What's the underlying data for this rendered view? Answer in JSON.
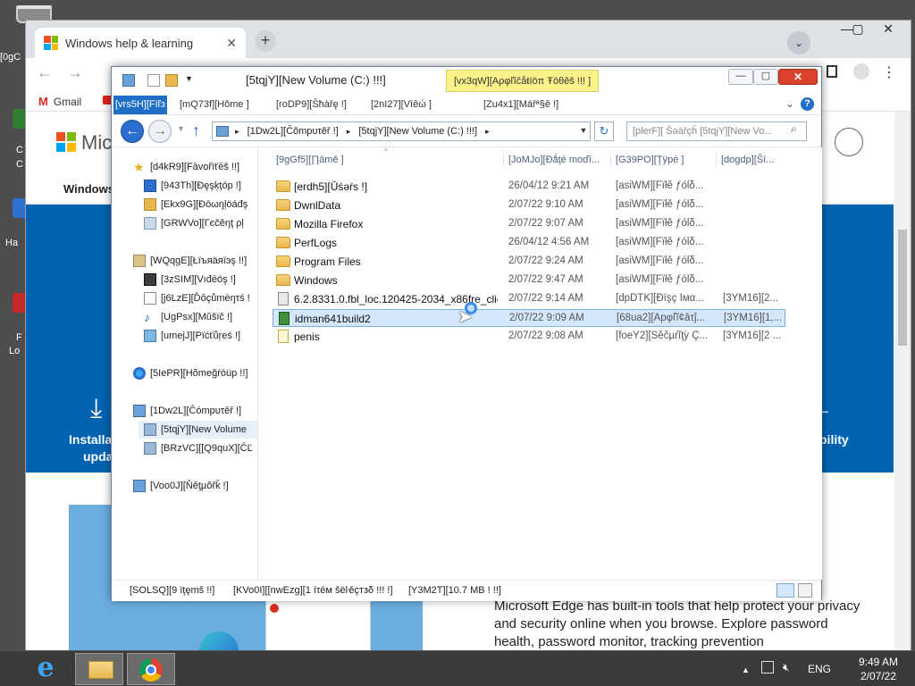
{
  "desktop": {
    "left_labels": [
      "[0gC",
      "C",
      "C",
      "Ha",
      "F",
      "Lo"
    ]
  },
  "browser": {
    "tab_title": "Windows help & learning",
    "tab_close": "✕",
    "new_tab": "+",
    "bookmarks": [
      "Gmail"
    ],
    "ms_logo_text": "Micr",
    "nav_text": "Windows",
    "hero_left": [
      "Installat",
      "upda"
    ],
    "hero_right": "bility",
    "description": "Microsoft Edge has built-in tools that help protect your privacy and security online when you browse. Explore password health, password monitor, tracking prevention"
  },
  "explorer": {
    "title": "[5tqjY][New Volume (C:) !!!]",
    "tooltip": "[vx3qW][Αρφľĭčåŧïöπ Ŧōθěš !!! ]",
    "window_controls": {
      "minimize": "—",
      "maximize": "▢",
      "close": "✕"
    },
    "ribbon_tabs": {
      "file": "[vrs5H][Fïľɜ ]",
      "home": "[mQ73f][Hǒme ]",
      "share": "[roDP9][Ŝħàřę !]",
      "view": "[2nI27][Vïêώ ]",
      "manage": "[Zu4x1][Mářª§ě !]"
    },
    "address": {
      "computer": "[1Dw2L][Ĉǒmpυτěř !]",
      "volume": "[5tqjY][New Volume (C:) !!!]",
      "sep": "▸"
    },
    "search_placeholder": "[plerF][ Šəàřçĥ [5tqjY][New Vo...",
    "nav": {
      "favorites": "[d4kR9][Fāvořïťēš !!]",
      "desktop": "[943Th][Đęşķţóp !]",
      "downloads": "[Ekx9G][Đōωŋļöáđş",
      "recent": "[GRWVo][Гєčěŋţ ρļ",
      "libraries": "[WQqgE][Łïъяäяïэş !!]",
      "videos": "[3zSIM][Vıđēöş !]",
      "documents": "[j6LzE][Ďȏçůmèŋτś !",
      "music": "[UgPsx][Mŭšïč !]",
      "pictures": "[umejJ][Pïćťůŗeś !]",
      "homegroup": "[5IePR][Hõmeğŕōüp !!]",
      "computer": "[1Dw2L][Ĉómpυτěř !]",
      "new_volume": "[5tqjY][New Volume",
      "other_drive": "[BRzVC][[Q9quX][ĈĽ",
      "network": "[Voo0J][Ňěţµŏřǩ !]"
    },
    "columns": {
      "name": "[9gGf5][∏āmě ]",
      "date": "[JoMJo][Ðǻţé moďī...",
      "type": "[G39PO][Ţÿpé ]",
      "size": "[dogdp][Šī..."
    },
    "files": [
      {
        "name": "[erdh5][Ŭśəŕs !]",
        "date": "26/04/12 9:21 AM",
        "type": "[asiWM][Fïłě ƒóĺδ...",
        "size": "",
        "icon": "folder-icon"
      },
      {
        "name": "DwnlData",
        "date": "2/07/22 9:10 AM",
        "type": "[asiWM][Fïłě ƒóĺδ...",
        "size": "",
        "icon": "folder-icon"
      },
      {
        "name": "Mozilla Firefox",
        "date": "2/07/22 9:07 AM",
        "type": "[asiWM][Fïłě ƒóĺδ...",
        "size": "",
        "icon": "folder-icon"
      },
      {
        "name": "PerfLogs",
        "date": "26/04/12 4:56 AM",
        "type": "[asiWM][Fïłě ƒóĺδ...",
        "size": "",
        "icon": "folder-icon"
      },
      {
        "name": "Program Files",
        "date": "2/07/22 9:24 AM",
        "type": "[asiWM][Fïłě ƒóĺδ...",
        "size": "",
        "icon": "folder-icon"
      },
      {
        "name": "Windows",
        "date": "2/07/22 9:47 AM",
        "type": "[asiWM][Fïłě ƒóĺδ...",
        "size": "",
        "icon": "folder-icon"
      },
      {
        "name": "6.2.8331.0.fbl_loc.120425-2034_x86fre_clie...",
        "date": "2/07/22 9:14 AM",
        "type": "[dpDTK][Ðïşç Ιмα...",
        "size": "[3YM16][2...",
        "icon": "disc-image-icon"
      },
      {
        "name": "idman641build2",
        "date": "2/07/22 9:09 AM",
        "type": "[68ua2][Āрφľĭ¢åτĵ...",
        "size": "[3YM16][1,...",
        "icon": "installer-icon"
      },
      {
        "name": "penis",
        "date": "2/07/22 9:08 AM",
        "type": "[foeY2][Ŝěčµŕĭţỳ Ç...",
        "size": "[3YM16][2 ...",
        "icon": "certificate-icon"
      }
    ],
    "status": {
      "items": "[SOLSQ][9 ïţęmš !!]",
      "selected": "[KVo0I][[nwEzg][1 ïτéм šëŀěçтзδ !!! !]",
      "size": "[Y3M2T][10.7 MB ! !!]"
    }
  },
  "taskbar": {
    "ie_glyph": "e",
    "language": "ENG",
    "time": "9:49 AM",
    "date": "2/07/22",
    "tray_arrow": "▲"
  },
  "colors": {
    "hero_blue": "#0063b1",
    "explorer_accent": "#2a6ed0",
    "close_red": "#d9412c",
    "selection": "#d5e8fb"
  }
}
